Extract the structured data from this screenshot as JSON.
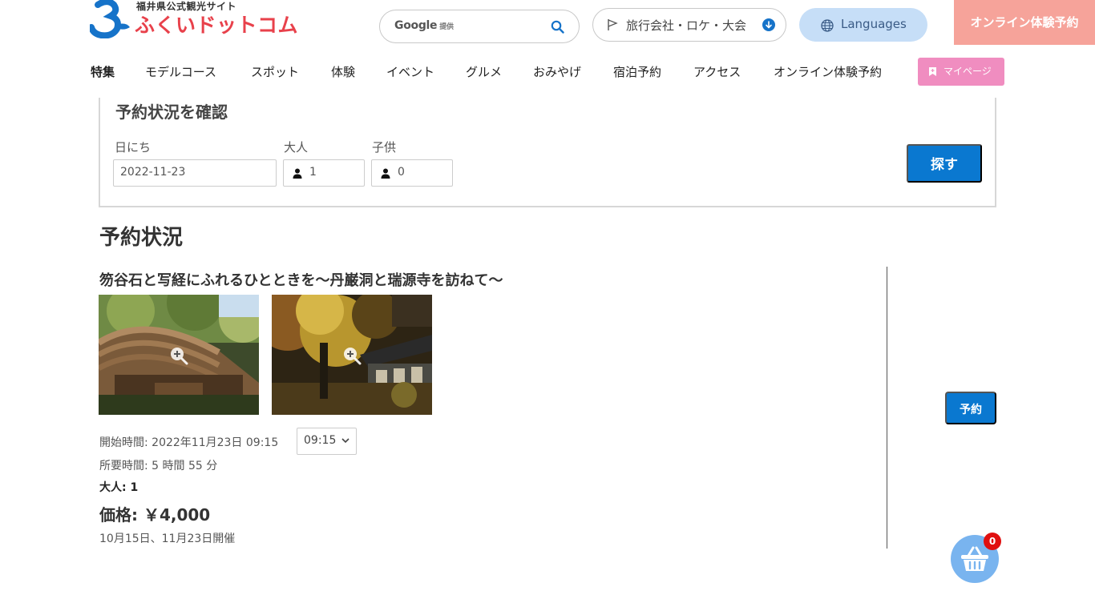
{
  "header": {
    "logo_subtitle": "福井県公式観光サイト",
    "logo_title": "ふくいドットコム",
    "search": {
      "brand": "Google",
      "provided": "提供",
      "placeholder": ""
    },
    "agency_button": "旅行会社・ロケ・大会",
    "languages_button": "Languages",
    "online_booking_button": "オンライン体験予約"
  },
  "nav": {
    "items": [
      {
        "label": "特集"
      },
      {
        "label": "モデルコース"
      },
      {
        "label": "スポット"
      },
      {
        "label": "体験"
      },
      {
        "label": "イベント"
      },
      {
        "label": "グルメ"
      },
      {
        "label": "おみやげ"
      },
      {
        "label": "宿泊予約"
      },
      {
        "label": "アクセス"
      },
      {
        "label": "オンライン体験予約"
      }
    ],
    "mypage": "マイページ"
  },
  "check": {
    "title": "予約状況を確認",
    "date_label": "日にち",
    "date_value": "2022-11-23",
    "adult_label": "大人",
    "adult_value": "1",
    "child_label": "子供",
    "child_value": "0",
    "search_button": "探す"
  },
  "status": {
    "heading": "予約状況",
    "tour": {
      "title": "笏谷石と写経にふれるひとときを～丹巌洞と瑞源寺を訪ねて～",
      "start_time": "開始時間: 2022年11月23日 09:15",
      "time_option": "09:15",
      "duration": "所要時間: 5 時間 55 分",
      "adults": "大人: 1",
      "price": "価格: ￥4,000",
      "dates": "10月15日、11月23日開催",
      "reserve_button": "予約"
    }
  },
  "cart": {
    "count": "0"
  },
  "colors": {
    "accent_blue": "#0a78d0",
    "logo_red": "#e8414b",
    "online_pink": "#f6a39a",
    "mypage_pink": "#f08dc0",
    "languages_bg": "#c6def7",
    "cart_bg": "#79b4ef",
    "badge_red": "#e01010"
  },
  "icons": [
    "mascot-icon",
    "search-icon",
    "flag-icon",
    "download-icon",
    "globe-icon",
    "bookmark-icon",
    "person-icon",
    "zoom-icon",
    "chevron-down-icon",
    "basket-icon"
  ]
}
